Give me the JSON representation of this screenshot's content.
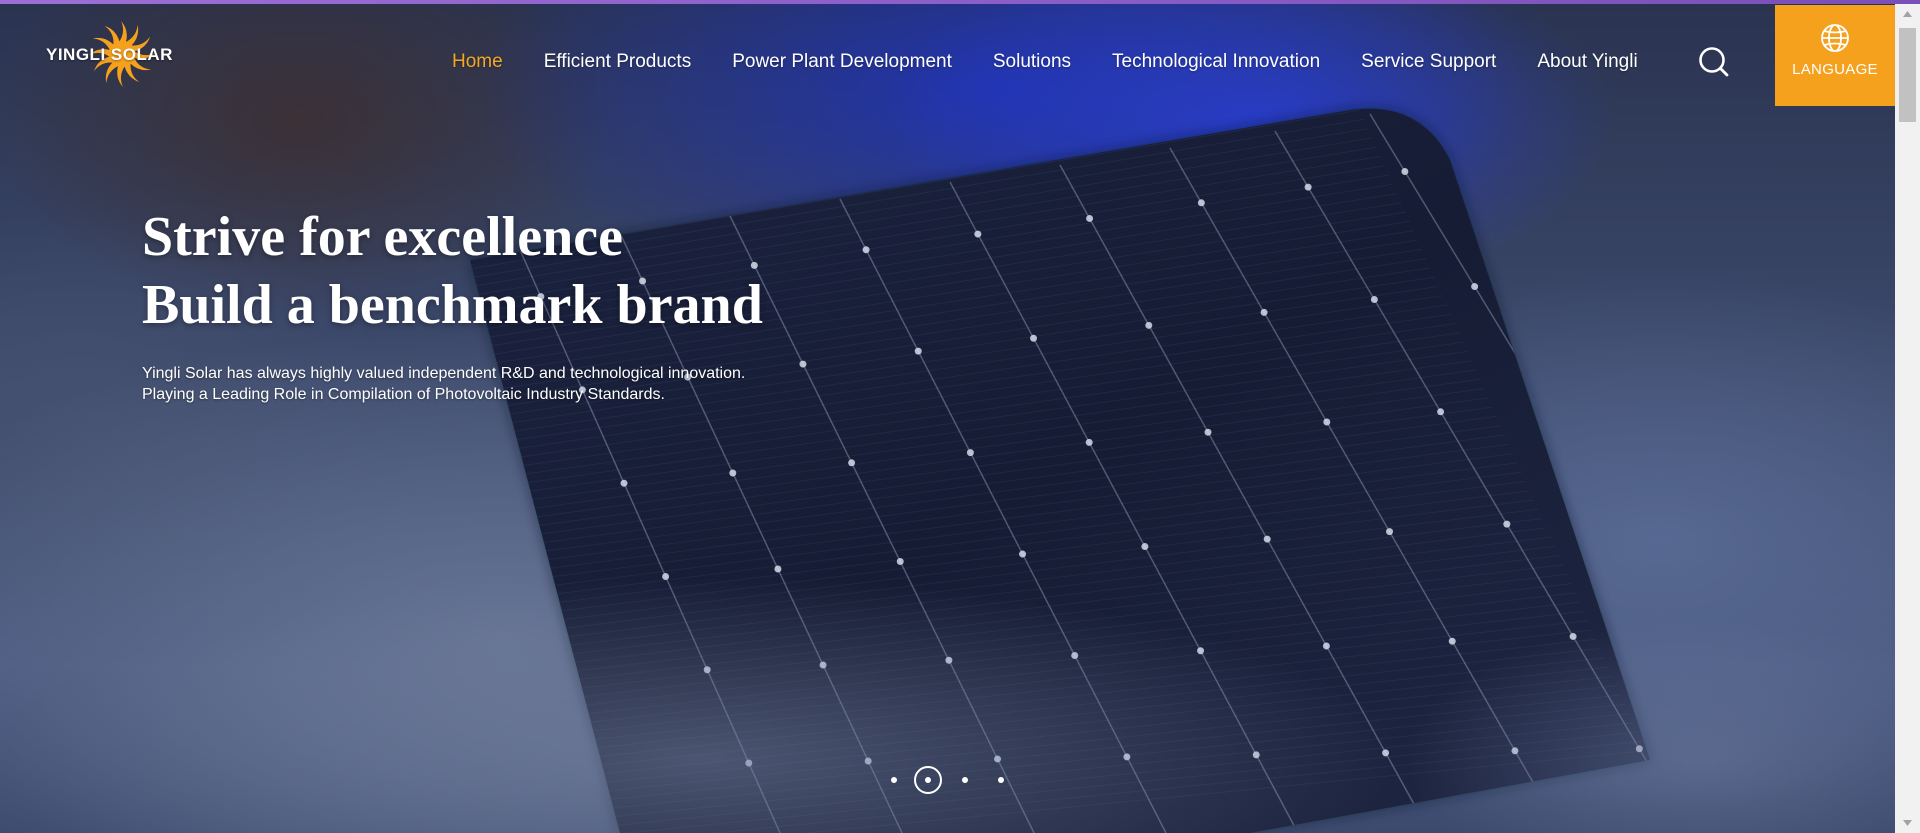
{
  "header": {
    "logo_text": "YINGLI SOLAR",
    "nav": [
      {
        "label": "Home",
        "active": true
      },
      {
        "label": "Efficient Products",
        "active": false
      },
      {
        "label": "Power Plant Development",
        "active": false
      },
      {
        "label": "Solutions",
        "active": false
      },
      {
        "label": "Technological Innovation",
        "active": false
      },
      {
        "label": "Service Support",
        "active": false
      },
      {
        "label": "About Yingli",
        "active": false
      }
    ],
    "search_icon": "search-icon",
    "language": {
      "label": "LANGUAGE",
      "icon": "globe-icon"
    }
  },
  "hero": {
    "title_line1": "Strive for excellence",
    "title_line2": "Build a benchmark brand",
    "desc_line1": "Yingli Solar has always highly valued independent R&D and technological innovation.",
    "desc_line2": "Playing a Leading Role in Compilation of Photovoltaic Industry Standards."
  },
  "slider": {
    "slide_count": 4,
    "active_index": 1
  },
  "colors": {
    "accent": "#f5a623",
    "language_bg": "#f5a11d",
    "top_accent": "#9b6fd6"
  }
}
